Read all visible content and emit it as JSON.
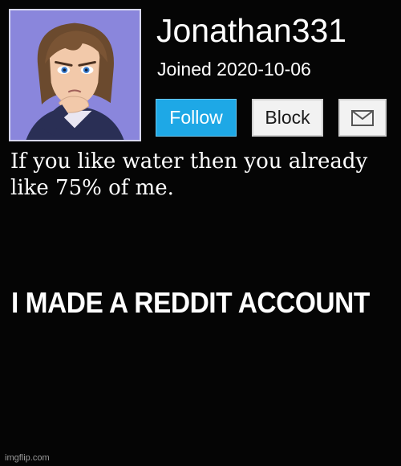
{
  "profile": {
    "username": "Jonathan331",
    "joined": "Joined 2020-10-06"
  },
  "buttons": {
    "follow_label": "Follow",
    "block_label": "Block",
    "message_icon": "envelope-icon"
  },
  "bio": "If you like water then you already like 75% of me.",
  "headline": "I MADE A REDDIT ACCOUNT",
  "watermark": "imgflip.com",
  "colors": {
    "background": "#050505",
    "follow_button": "#1ea8e6",
    "avatar_background": "#8c8ce0"
  }
}
